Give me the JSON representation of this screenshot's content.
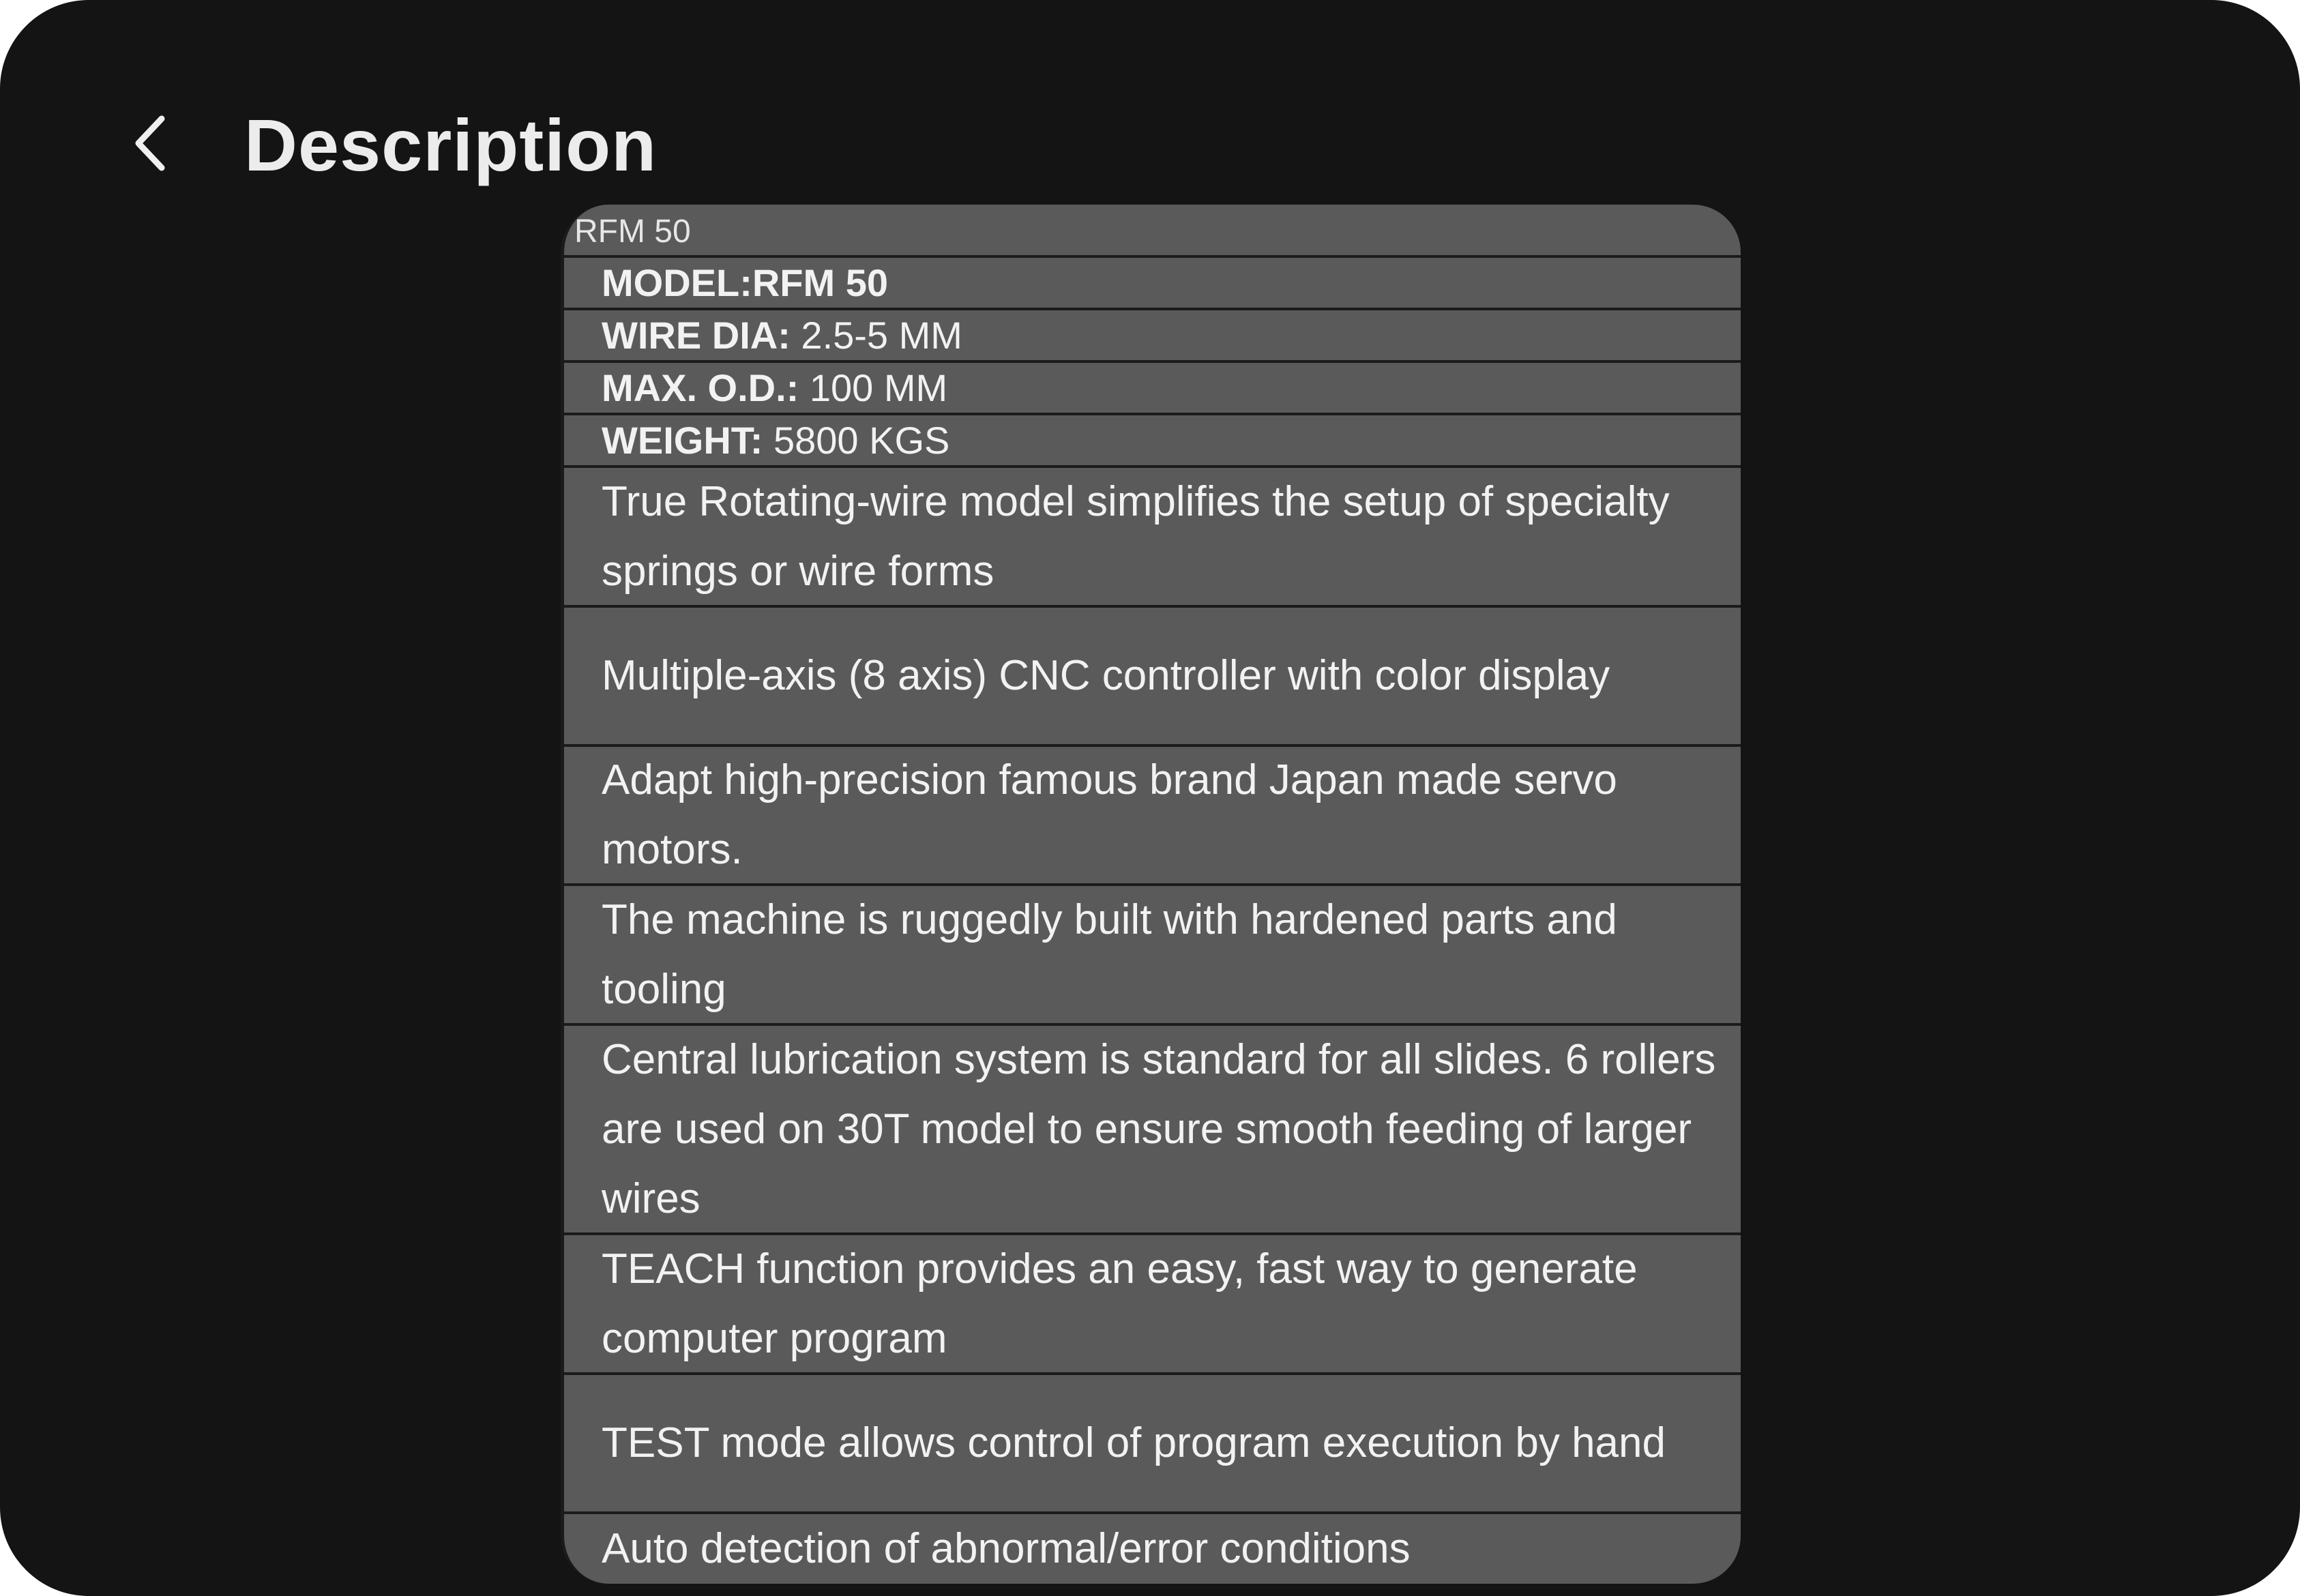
{
  "header": {
    "title": "Description",
    "back_icon": "chevron-left-icon"
  },
  "colors": {
    "screen_background": "#141414",
    "card_background": "#5a5a5a",
    "divider": "#1b1b1b",
    "text": "#f2f2f2"
  },
  "card": {
    "caption": "RFM 50",
    "specs": [
      {
        "key": "MODEL:RFM 50",
        "value": ""
      },
      {
        "key": "WIRE DIA:",
        "value": " 2.5-5 MM"
      },
      {
        "key": "MAX. O.D.:",
        "value": " 100 MM"
      },
      {
        "key": "WEIGHT:",
        "value": " 5800 KGS"
      }
    ],
    "features": [
      "True Rotating-wire model simplifies the setup of specialty springs or wire forms",
      "Multiple-axis (8 axis) CNC controller with color display",
      "Adapt high-precision famous brand Japan made servo motors.",
      "The machine is ruggedly built with hardened parts and tooling",
      "Central lubrication system is standard for all slides. 6 rollers are used on 30T model to ensure smooth feeding of larger wires",
      "TEACH function provides an easy, fast way to generate computer program",
      "TEST mode allows control of program execution by hand",
      "Auto detection of abnormal/error conditions"
    ]
  }
}
